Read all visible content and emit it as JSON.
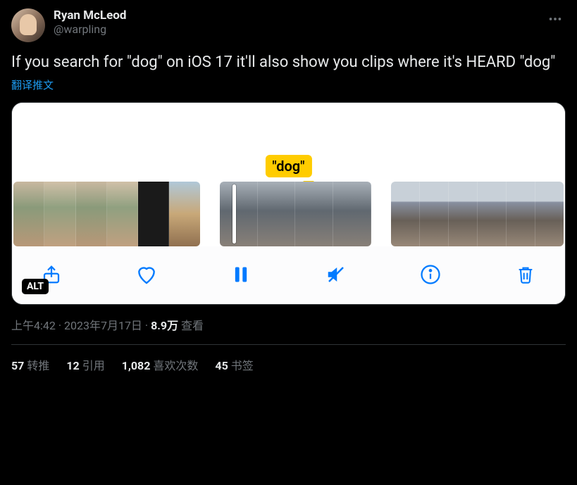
{
  "author": {
    "display_name": "Ryan McLeod",
    "handle": "@warpling"
  },
  "tweet_text": "If you search for \"dog\" on iOS 17 it'll also show you clips where it's HEARD \"dog\"",
  "translate_label": "翻译推文",
  "media": {
    "search_tag": "\"dog\"",
    "alt_badge": "ALT"
  },
  "meta": {
    "time": "上午4:42",
    "date": "2023年7月17日",
    "views_count": "8.9万",
    "views_label": "查看",
    "separator": " · "
  },
  "stats": {
    "retweets": {
      "count": "57",
      "label": "转推"
    },
    "quotes": {
      "count": "12",
      "label": "引用"
    },
    "likes": {
      "count": "1,082",
      "label": "喜欢次数"
    },
    "bookmarks": {
      "count": "45",
      "label": "书签"
    }
  }
}
